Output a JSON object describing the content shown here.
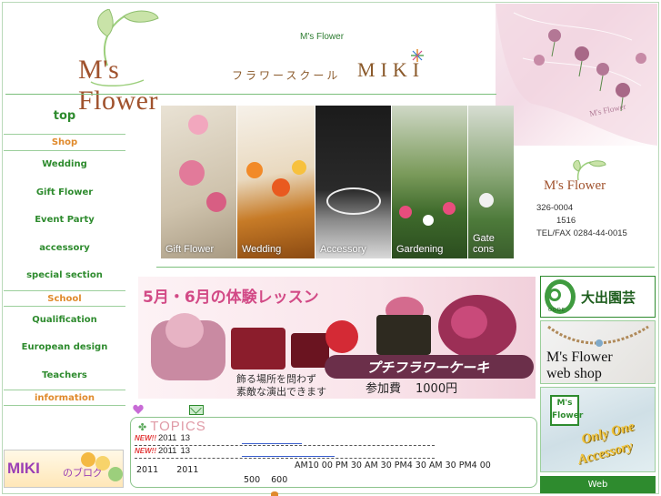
{
  "header": {
    "logo_text": "M's Flower",
    "site_title": "M's Flower",
    "school_jp": "フラワースクール",
    "school_en": "MIKI"
  },
  "sidebar": {
    "top": "top",
    "sections": [
      {
        "category": "Shop",
        "items": [
          "Wedding",
          "Gift Flower",
          "Event  Party",
          "accessory",
          "special section"
        ]
      },
      {
        "category": "School",
        "items": [
          "Qualification",
          "European design",
          "Teachers"
        ]
      },
      {
        "category": "information",
        "items": []
      }
    ],
    "blog": {
      "title": "MIKI",
      "suffix": "のブログ"
    }
  },
  "photo_strip": [
    {
      "label": "Gift Flower"
    },
    {
      "label": "Wedding"
    },
    {
      "label": "Accessory"
    },
    {
      "label": "Gardening"
    },
    {
      "label": "Gate cons"
    }
  ],
  "contact": {
    "logo_text": "M's Flower",
    "postal": "326-0004",
    "address": "1516",
    "tel": "TEL/FAX 0284-44-0015"
  },
  "banner": {
    "title": "5月・6月の体験レッスン",
    "ribbon": "プチフラワーケーキ",
    "note_line1": "飾る場所を問わず",
    "note_line2": "素敵な演出できます",
    "fee_label": "参加費",
    "fee_value": "1000円"
  },
  "right_banners": {
    "oode_name": "大出園芸",
    "oode_sub": "OODE",
    "webshop_line1": "M's Flower",
    "webshop_line2": "web shop",
    "stamp_line1": "M's",
    "stamp_line2": "Flower",
    "only_one_1": "Only One",
    "only_one_2": "Accessory",
    "web_button": "Web"
  },
  "topics": {
    "heading": "TOPICS",
    "new_badge": "NEW!!",
    "rows": [
      {
        "year": "2011",
        "month": "13"
      },
      {
        "year": "2011",
        "month": "13"
      }
    ],
    "row3": {
      "date1": "2011",
      "date2": "2011",
      "schedule": "AM10 00 PM  30   AM  30 PM4 30   AM  30 PM4 00"
    },
    "row4": {
      "v1": "500",
      "v2": "600"
    }
  },
  "colors": {
    "accent_green": "#2e8b2e",
    "category_orange": "#e08a2c",
    "logo_brown": "#a0522d",
    "banner_pink": "#d24a86"
  }
}
